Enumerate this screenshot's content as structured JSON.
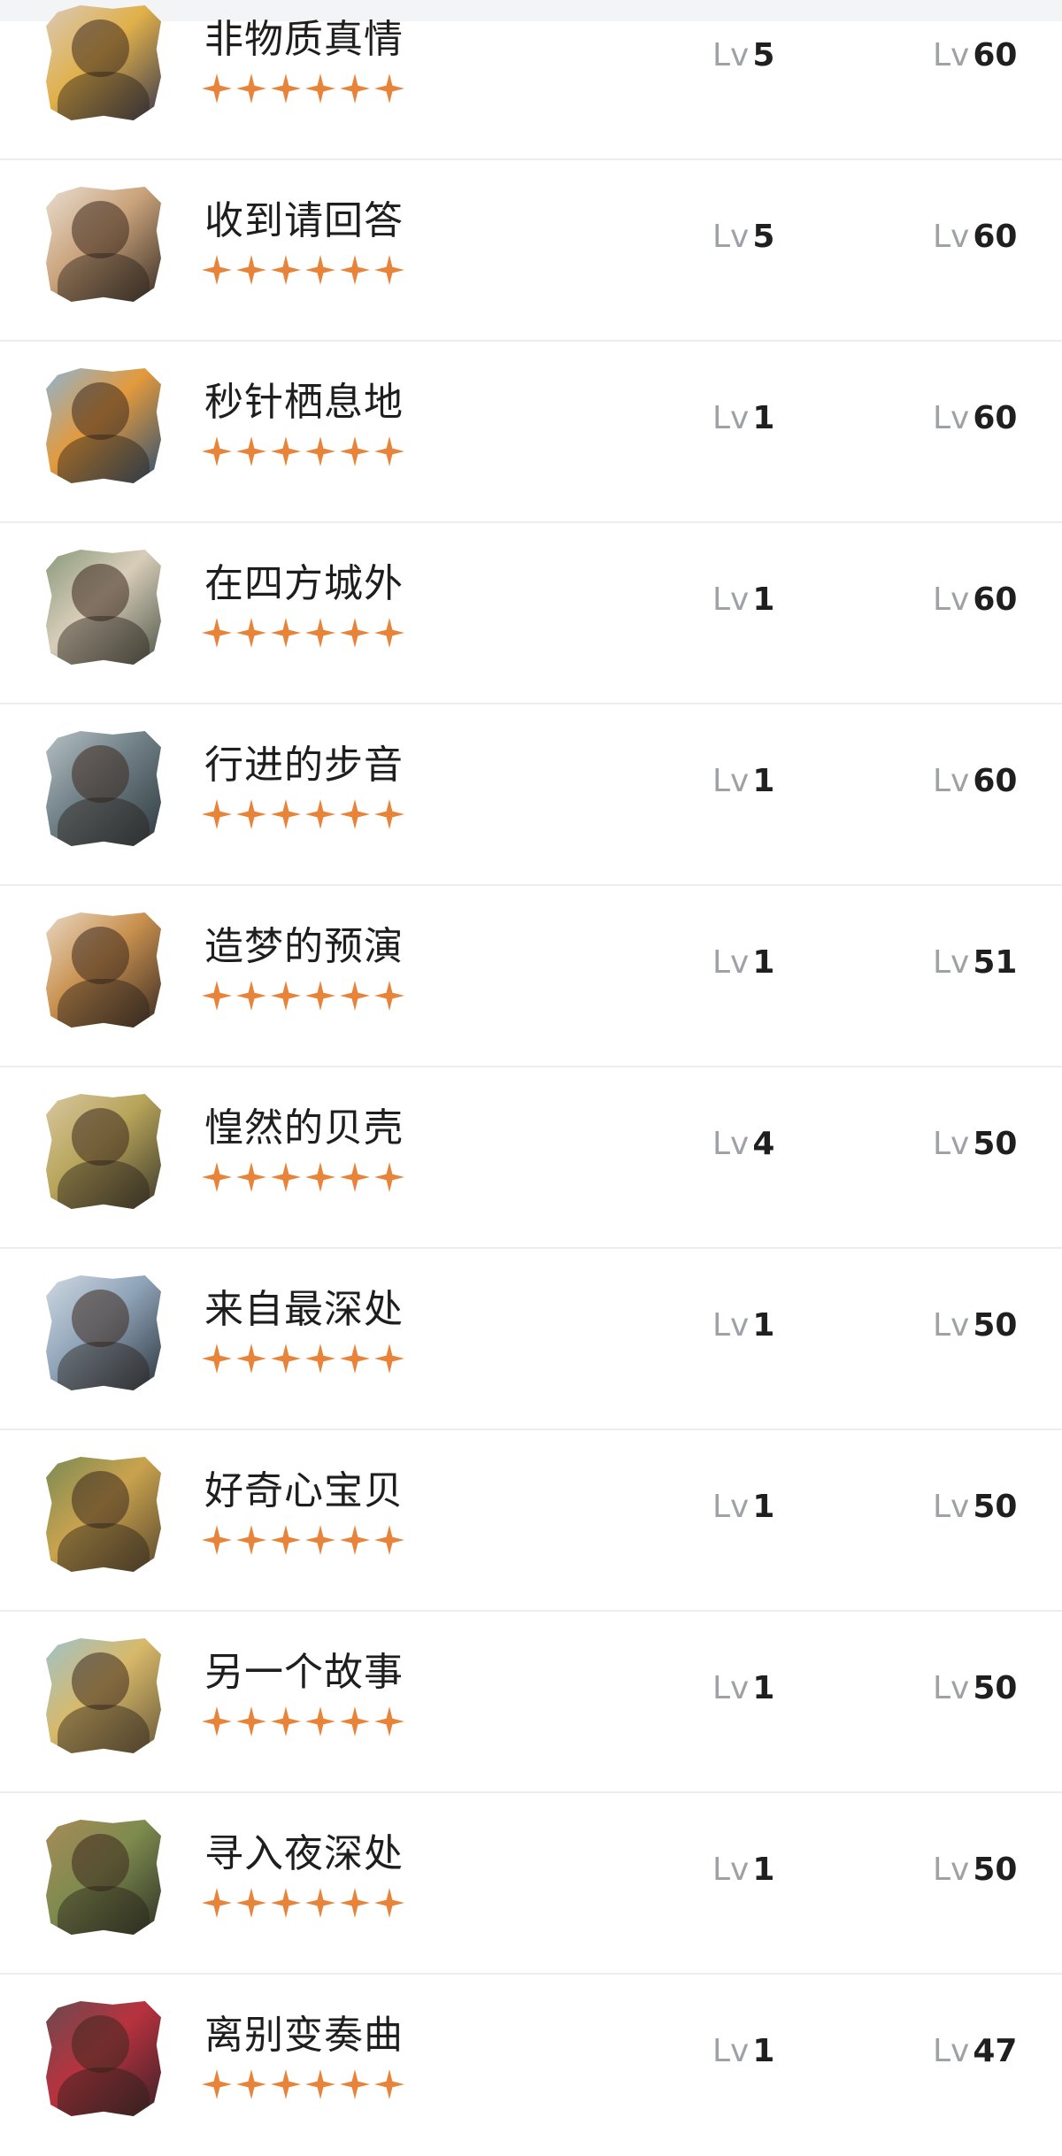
{
  "level_prefix": "Lv",
  "colors": {
    "star": "#e8843a",
    "divider": "#ededed",
    "top_strip": "#f3f4f6"
  },
  "characters": [
    {
      "name": "非物质真情",
      "stars": 6,
      "skill_level": "5",
      "level": "60",
      "avatar_icon": "portrait-icon",
      "avatar_colors": [
        "#3b3a4e",
        "#e0b04a",
        "#d9c9b8"
      ]
    },
    {
      "name": "收到请回答",
      "stars": 6,
      "skill_level": "5",
      "level": "60",
      "avatar_icon": "portrait-icon",
      "avatar_colors": [
        "#3a2f28",
        "#c9a27a",
        "#e8ddd0"
      ]
    },
    {
      "name": "秒针栖息地",
      "stars": 6,
      "skill_level": "1",
      "level": "60",
      "avatar_icon": "portrait-icon",
      "avatar_colors": [
        "#2d4f73",
        "#e39a3c",
        "#8fb3cf"
      ]
    },
    {
      "name": "在四方城外",
      "stars": 6,
      "skill_level": "1",
      "level": "60",
      "avatar_icon": "portrait-icon",
      "avatar_colors": [
        "#50584a",
        "#d8cdb9",
        "#8a9a7c"
      ]
    },
    {
      "name": "行进的步音",
      "stars": 6,
      "skill_level": "1",
      "level": "60",
      "avatar_icon": "portrait-icon",
      "avatar_colors": [
        "#2f3a3f",
        "#6f7f86",
        "#b6c0c4"
      ]
    },
    {
      "name": "造梦的预演",
      "stars": 6,
      "skill_level": "1",
      "level": "51",
      "avatar_icon": "portrait-icon",
      "avatar_colors": [
        "#3a2c25",
        "#c8904e",
        "#e8d7c3"
      ]
    },
    {
      "name": "惶然的贝壳",
      "stars": 6,
      "skill_level": "4",
      "level": "50",
      "avatar_icon": "portrait-icon",
      "avatar_colors": [
        "#3e3a2b",
        "#b7a45a",
        "#d8c7a0"
      ]
    },
    {
      "name": "来自最深处",
      "stars": 6,
      "skill_level": "1",
      "level": "50",
      "avatar_icon": "portrait-icon",
      "avatar_colors": [
        "#2e3640",
        "#8fa4b8",
        "#cfd8e2"
      ]
    },
    {
      "name": "好奇心宝贝",
      "stars": 6,
      "skill_level": "1",
      "level": "50",
      "avatar_icon": "portrait-icon",
      "avatar_colors": [
        "#5c4a2f",
        "#c9a34e",
        "#7b8a55"
      ]
    },
    {
      "name": "另一个故事",
      "stars": 6,
      "skill_level": "1",
      "level": "50",
      "avatar_icon": "portrait-icon",
      "avatar_colors": [
        "#6a5a3a",
        "#d8b96a",
        "#9fc2c8"
      ]
    },
    {
      "name": "寻入夜深处",
      "stars": 6,
      "skill_level": "1",
      "level": "50",
      "avatar_icon": "portrait-icon",
      "avatar_colors": [
        "#2f3427",
        "#7e8b4e",
        "#a88a5a"
      ]
    },
    {
      "name": "离别变奏曲",
      "stars": 6,
      "skill_level": "1",
      "level": "47",
      "avatar_icon": "portrait-icon",
      "avatar_colors": [
        "#3c2228",
        "#b8323f",
        "#6a4a4e"
      ]
    }
  ]
}
